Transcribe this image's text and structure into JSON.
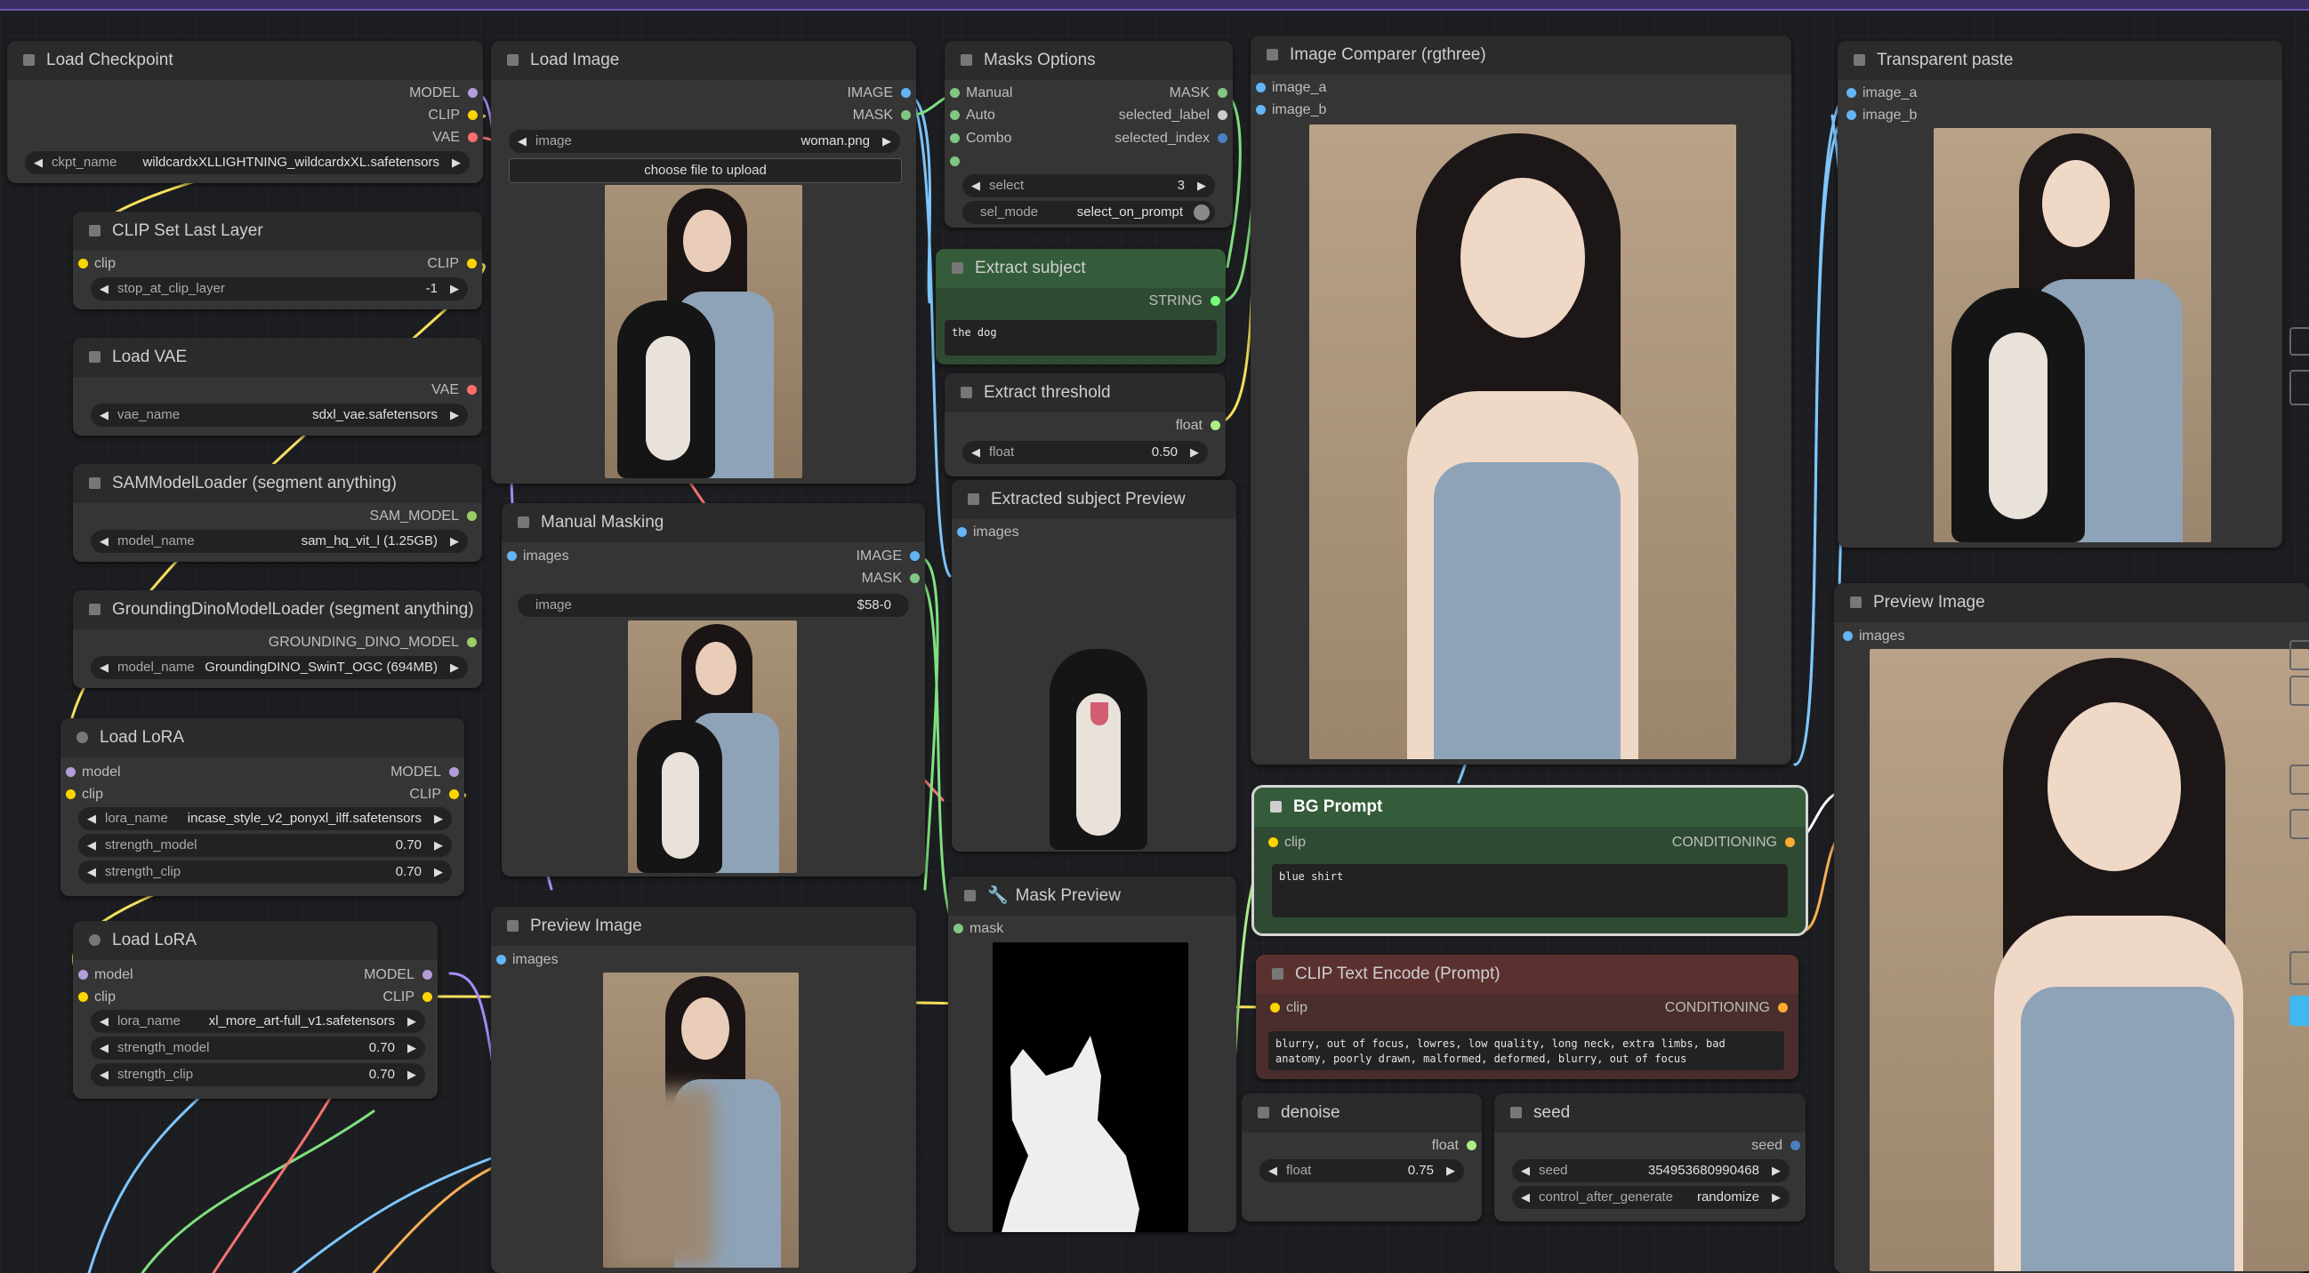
{
  "nodes": {
    "load_checkpoint": {
      "title": "Load Checkpoint",
      "outputs": [
        "MODEL",
        "CLIP",
        "VAE"
      ],
      "widget_label": "ckpt_name",
      "widget_value": "wildcardxXLLIGHTNING_wildcardxXL.safetensors"
    },
    "clip_set_last_layer": {
      "title": "CLIP Set Last Layer",
      "input": "clip",
      "output": "CLIP",
      "widget_label": "stop_at_clip_layer",
      "widget_value": "-1"
    },
    "load_vae": {
      "title": "Load VAE",
      "output": "VAE",
      "widget_label": "vae_name",
      "widget_value": "sdxl_vae.safetensors"
    },
    "sam_loader": {
      "title": "SAMModelLoader (segment anything)",
      "output": "SAM_MODEL",
      "widget_label": "model_name",
      "widget_value": "sam_hq_vit_l (1.25GB)"
    },
    "dino_loader": {
      "title": "GroundingDinoModelLoader (segment anything)",
      "output": "GROUNDING_DINO_MODEL",
      "widget_label": "model_name",
      "widget_value": "GroundingDINO_SwinT_OGC (694MB)"
    },
    "lora1": {
      "title": "Load LoRA",
      "inputs": [
        "model",
        "clip"
      ],
      "outputs": [
        "MODEL",
        "CLIP"
      ],
      "lora_label": "lora_name",
      "lora_value": "incase_style_v2_ponyxl_ilff.safetensors",
      "sm_label": "strength_model",
      "sm_value": "0.70",
      "sc_label": "strength_clip",
      "sc_value": "0.70"
    },
    "lora2": {
      "title": "Load LoRA",
      "inputs": [
        "model",
        "clip"
      ],
      "outputs": [
        "MODEL",
        "CLIP"
      ],
      "lora_label": "lora_name",
      "lora_value": "xl_more_art-full_v1.safetensors",
      "sm_label": "strength_model",
      "sm_value": "0.70",
      "sc_label": "strength_clip",
      "sc_value": "0.70"
    },
    "load_image": {
      "title": "Load Image",
      "outputs": [
        "IMAGE",
        "MASK"
      ],
      "widget_label": "image",
      "widget_value": "woman.png",
      "button": "choose file to upload"
    },
    "manual_masking": {
      "title": "Manual Masking",
      "input": "images",
      "outputs": [
        "IMAGE",
        "MASK"
      ],
      "widget_label": "image",
      "widget_value": "$58-0"
    },
    "preview_image_left": {
      "title": "Preview Image",
      "input": "images"
    },
    "masks_options": {
      "title": "Masks Options",
      "inputs": [
        "Manual",
        "Auto",
        "Combo"
      ],
      "outputs": [
        "MASK",
        "selected_label",
        "selected_index"
      ],
      "select_label": "select",
      "select_value": "3",
      "mode_label": "sel_mode",
      "mode_value": "select_on_prompt"
    },
    "extract_subject": {
      "title": "Extract subject",
      "output": "STRING",
      "text": "the dog"
    },
    "extract_threshold": {
      "title": "Extract threshold",
      "output": "float",
      "widget_label": "float",
      "widget_value": "0.50"
    },
    "extracted_preview": {
      "title": "Extracted subject Preview",
      "input": "images"
    },
    "mask_preview": {
      "title": "Mask Preview",
      "input": "mask"
    },
    "image_comparer": {
      "title": "Image Comparer (rgthree)",
      "inputs": [
        "image_a",
        "image_b"
      ]
    },
    "bg_prompt": {
      "title": "BG Prompt",
      "input": "clip",
      "output": "CONDITIONING",
      "text": "blue shirt"
    },
    "clip_text_encode": {
      "title": "CLIP Text Encode (Prompt)",
      "input": "clip",
      "output": "CONDITIONING",
      "text": "blurry, out of focus, lowres, low quality, long neck, extra limbs, bad anatomy, poorly drawn, malformed, deformed, blurry, out of focus"
    },
    "denoise": {
      "title": "denoise",
      "output": "float",
      "widget_label": "float",
      "widget_value": "0.75"
    },
    "seed": {
      "title": "seed",
      "output": "seed",
      "widget_label": "seed",
      "widget_value": "354953680990468",
      "cag_label": "control_after_generate",
      "cag_value": "randomize"
    },
    "transparent_paste": {
      "title": "Transparent paste",
      "inputs": [
        "image_a",
        "image_b"
      ]
    },
    "preview_image_right": {
      "title": "Preview Image",
      "input": "images"
    }
  },
  "colors": {
    "model": "#b39ddb",
    "clip": "#ffd500",
    "vae": "#ff6e6e",
    "image": "#64b5f6",
    "mask": "#81c784",
    "conditioning": "#ffa931",
    "float": "#aaee88",
    "string": "#77ff77",
    "sam": "#9ccc65",
    "wire_blue": "#7ec6ff",
    "wire_green": "#7fe07f",
    "wire_yellow": "#f6e05e",
    "wire_purple": "#a78bfa",
    "wire_red": "#f87171",
    "wire_orange": "#f6ad55"
  }
}
